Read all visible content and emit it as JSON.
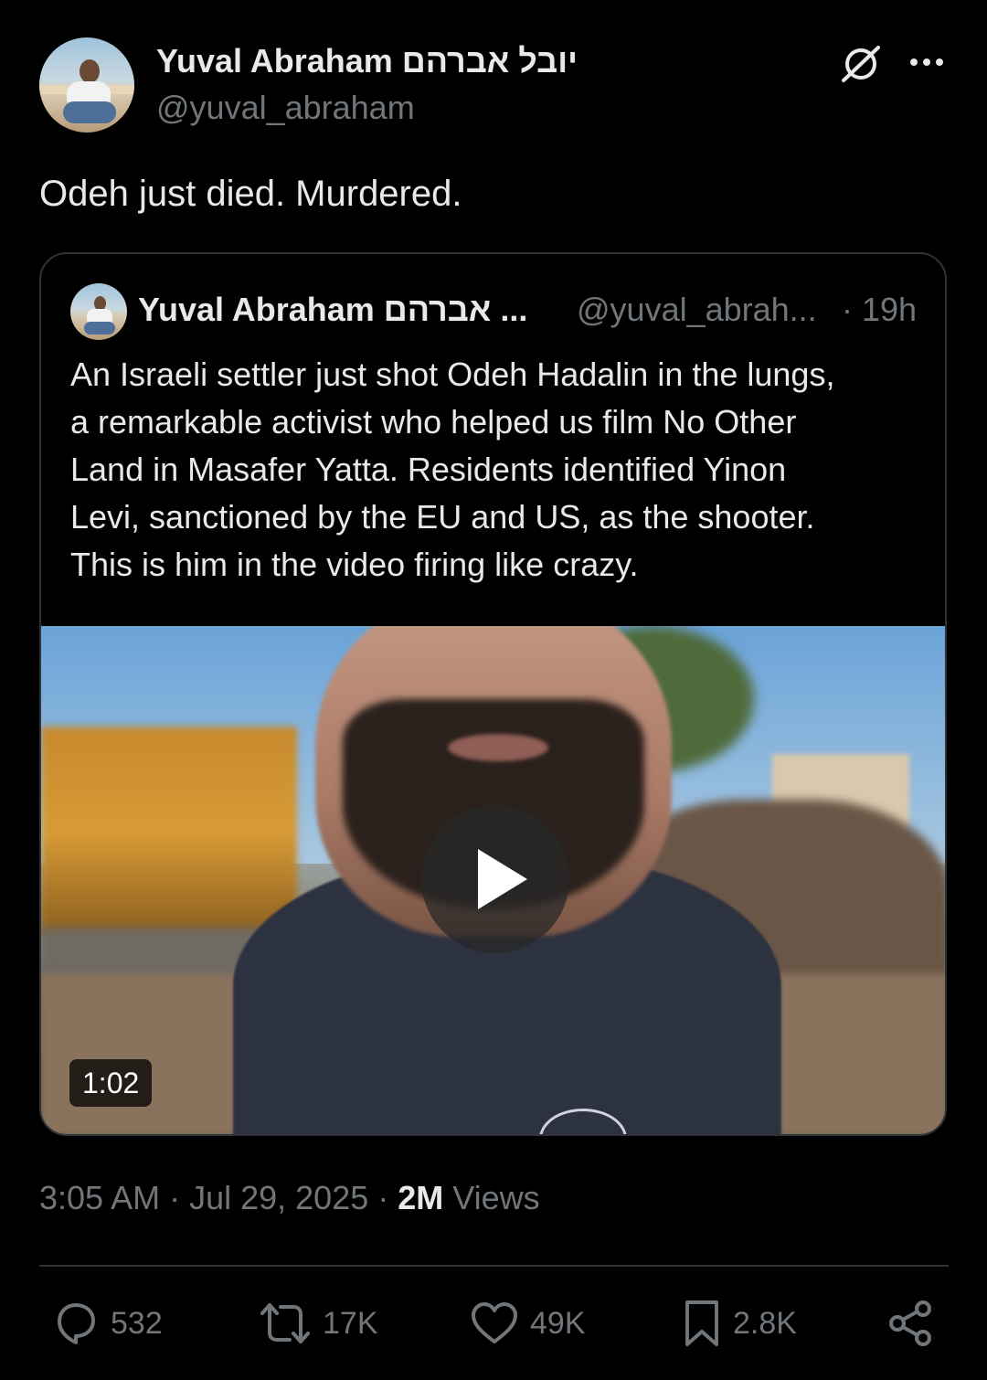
{
  "author": {
    "display_name": "Yuval Abraham יובל אברהם",
    "handle": "@yuval_abraham"
  },
  "header_icons": {
    "grok": "grok-icon",
    "more": "more-icon"
  },
  "tweet": {
    "text": "Odeh just died. Murdered."
  },
  "quoted": {
    "display_name": "Yuval Abraham אברהם ...",
    "handle": "@yuval_abrah...",
    "separator": "·",
    "time": "19h",
    "text_lines": [
      "An Israeli settler just shot Odeh Hadalin in the lungs,",
      "a remarkable activist who helped us film No Other",
      "Land in Masafer Yatta. Residents identified Yinon",
      "Levi, sanctioned by the EU and US, as the shooter.",
      "This is him in the video firing like crazy."
    ],
    "video": {
      "duration": "1:02"
    }
  },
  "meta": {
    "time": "3:05 AM",
    "sep1": " · ",
    "date": "Jul 29, 2025",
    "sep2": " · ",
    "views_count": "2M",
    "views_label": " Views"
  },
  "actions": {
    "replies": "532",
    "reposts": "17K",
    "likes": "49K",
    "bookmarks": "2.8K"
  },
  "colors": {
    "background": "#000000",
    "primary_text": "#e7e9ea",
    "secondary_text": "#71767b",
    "border": "#2f3336"
  }
}
